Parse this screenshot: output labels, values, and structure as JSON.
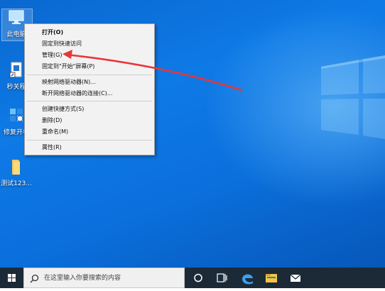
{
  "desktop": {
    "icons": [
      {
        "label": "此电脑",
        "icon": "computer-icon"
      },
      {
        "label": "秒关程",
        "icon": "app-shortcut-icon"
      },
      {
        "label": "修复开机",
        "icon": "repair-tool-icon"
      },
      {
        "label": "测试123...",
        "icon": "folder-icon"
      }
    ]
  },
  "context_menu": {
    "items": [
      {
        "label": "打开(O)",
        "bold": true
      },
      {
        "label": "固定到快速访问"
      },
      {
        "label": "管理(G)"
      },
      {
        "label": "固定到\"开始\"屏幕(P)"
      },
      {
        "label": "映射网络驱动器(N)..."
      },
      {
        "label": "断开网络驱动器的连接(C)..."
      },
      {
        "label": "创建快捷方式(S)"
      },
      {
        "label": "删除(D)"
      },
      {
        "label": "重命名(M)"
      },
      {
        "label": "属性(R)"
      }
    ]
  },
  "annotation": {
    "color": "#e8353a"
  },
  "taskbar": {
    "search_placeholder": "在这里输入你要搜索的内容",
    "icons": [
      "windows-start-icon",
      "search-icon",
      "cortana-circle-icon",
      "task-view-icon",
      "edge-browser-icon",
      "file-explorer-icon",
      "mail-icon"
    ]
  },
  "colors": {
    "desktop_blue": "#0b6fdc",
    "taskbar": "#1c2a38",
    "menu_bg": "#f2f2f2"
  }
}
